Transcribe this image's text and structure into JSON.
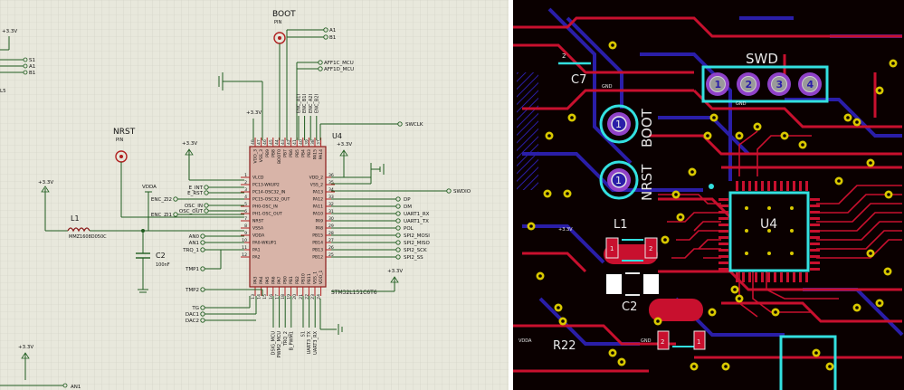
{
  "schematic": {
    "colors": {
      "background": "#e8e8dc",
      "grid": "#cfcfc3",
      "wire": "#1f5c1f",
      "chip_fill": "#d8b4a8",
      "chip_border": "#8a1a1a",
      "pin_red": "#b02020",
      "text": "#111111"
    },
    "chip": {
      "ref": "U4",
      "part": "STM32L151C6T6",
      "left_pins": [
        {
          "num": "1",
          "name": "VLCD"
        },
        {
          "num": "2",
          "name": "PC13-WKUP2"
        },
        {
          "num": "3",
          "name": "PC14-OSC32_IN"
        },
        {
          "num": "4",
          "name": "PC15-OSC32_OUT"
        },
        {
          "num": "5",
          "name": "PH0-OSC_IN"
        },
        {
          "num": "6",
          "name": "PH1-OSC_OUT"
        },
        {
          "num": "7",
          "name": "NRST"
        },
        {
          "num": "8",
          "name": "VSSA"
        },
        {
          "num": "9",
          "name": "VDDA"
        },
        {
          "num": "10",
          "name": "PA0-WKUP1"
        },
        {
          "num": "11",
          "name": "PA1"
        },
        {
          "num": "12",
          "name": "PA2"
        }
      ],
      "right_pins": [
        {
          "num": "36",
          "name": "VDD_2"
        },
        {
          "num": "35",
          "name": "VSS_2"
        },
        {
          "num": "34",
          "name": "PA13"
        },
        {
          "num": "33",
          "name": "PA12"
        },
        {
          "num": "32",
          "name": "PA11"
        },
        {
          "num": "31",
          "name": "PA10"
        },
        {
          "num": "30",
          "name": "PA9"
        },
        {
          "num": "29",
          "name": "PA8"
        },
        {
          "num": "28",
          "name": "PB15"
        },
        {
          "num": "27",
          "name": "PB14"
        },
        {
          "num": "26",
          "name": "PB13"
        },
        {
          "num": "25",
          "name": "PB12"
        }
      ],
      "top_pins": [
        {
          "num": "48",
          "name": "VDD_3"
        },
        {
          "num": "47",
          "name": "VSS_3"
        },
        {
          "num": "46",
          "name": "PB9"
        },
        {
          "num": "45",
          "name": "PB8"
        },
        {
          "num": "44",
          "name": "BOOT0"
        },
        {
          "num": "43",
          "name": "PB7"
        },
        {
          "num": "42",
          "name": "PB6"
        },
        {
          "num": "41",
          "name": "PB5"
        },
        {
          "num": "40",
          "name": "PB4"
        },
        {
          "num": "39",
          "name": "PB3"
        },
        {
          "num": "38",
          "name": "PA15"
        },
        {
          "num": "37",
          "name": "PA14"
        }
      ],
      "bottom_pins": [
        {
          "num": "13",
          "name": "PA3"
        },
        {
          "num": "14",
          "name": "PA4"
        },
        {
          "num": "15",
          "name": "PA5"
        },
        {
          "num": "16",
          "name": "PA6"
        },
        {
          "num": "17",
          "name": "PA7"
        },
        {
          "num": "18",
          "name": "PB0"
        },
        {
          "num": "19",
          "name": "PB1"
        },
        {
          "num": "20",
          "name": "PB2"
        },
        {
          "num": "21",
          "name": "PB10"
        },
        {
          "num": "22",
          "name": "PB11"
        },
        {
          "num": "23",
          "name": "VSS_1"
        },
        {
          "num": "24",
          "name": "VDD_1"
        }
      ]
    },
    "left_nets": [
      "E_INT",
      "E_RST",
      "ENC_ZI2",
      "OSC_IN",
      "OSC_OUT",
      "ENC_ZI1",
      "AN0",
      "AN1",
      "TRQ_1",
      "TMP1",
      "TMP2",
      "TG",
      "DAC1",
      "DAC2"
    ],
    "right_nets": [
      "DP",
      "DM",
      "UART1_RX",
      "UART1_TX",
      "POL",
      "SPI2_MOSI",
      "SPI2_MISO",
      "SPI2_SCK",
      "SPI2_SS"
    ],
    "top_nets": [
      "A1",
      "B1",
      "AFF1C_MCU",
      "AFF1D_MCU",
      "ENC_A1I",
      "ENC_B1I",
      "ENC_A2I",
      "ENC_B2I"
    ],
    "bottom_nets": [
      "DSIG_MCU",
      "PWM2_MCU",
      "TRQ_2",
      "B_PWM1",
      "S1",
      "UART3_TX",
      "UART3_RX"
    ],
    "swclk": "SWCLK",
    "swdio": "SWDIO",
    "boot": {
      "label": "BOOT",
      "sub": "PIN"
    },
    "nrst": {
      "label": "NRST",
      "sub": "PIN"
    },
    "power_label": "+3.3V",
    "vdda_label": "VDDA",
    "inductor": {
      "ref": "L1",
      "part": "MMZ1608D050C"
    },
    "capacitor": {
      "ref": "C2",
      "value": "100nF"
    },
    "left_edge_nets": [
      "S1",
      "A1",
      "B1",
      "L5"
    ],
    "bottom_edge_net": "AN1",
    "bottom_power": "+3.3V"
  },
  "pcb": {
    "colors": {
      "background": "#0a0000",
      "trace_red": "#c8102e",
      "trace_blue": "#2a1ea8",
      "outline": "#33e0e0",
      "pad_purple": "#8f42c8",
      "pad_gray": "#9a9a9a",
      "via_yellow": "#d8c800",
      "text": "#e8e8e8"
    },
    "labels": {
      "swd": "SWD",
      "boot": "BOOT",
      "nrst": "NRST",
      "u4": "U4",
      "l1": "L1",
      "c2": "C2",
      "c7": "C7",
      "r22": "R22",
      "gnd": "GND",
      "vdda": "VDDA",
      "vcc": "+3.3V"
    },
    "swd_pads": [
      "1",
      "2",
      "3",
      "4"
    ],
    "test_pad_label": "1",
    "inductor_pads": [
      "1",
      "2"
    ],
    "bottom_part_pads": [
      "2",
      "1"
    ],
    "c7_pad": "2"
  }
}
